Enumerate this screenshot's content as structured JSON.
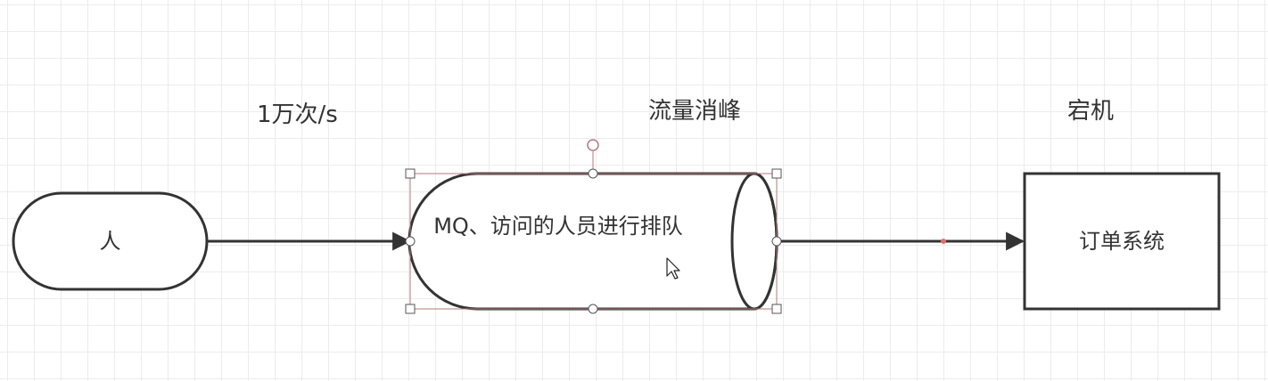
{
  "labels": {
    "rate": "1万次/s",
    "mq_role": "流量消峰",
    "order_state": "宕机"
  },
  "nodes": {
    "person": "人",
    "mq": "MQ、访问的人员进行排队",
    "order_system": "订单系统"
  },
  "colors": {
    "stroke": "#333333",
    "selection": "#b37a7a",
    "handle": "#555555",
    "waypoint": "#e07070"
  }
}
